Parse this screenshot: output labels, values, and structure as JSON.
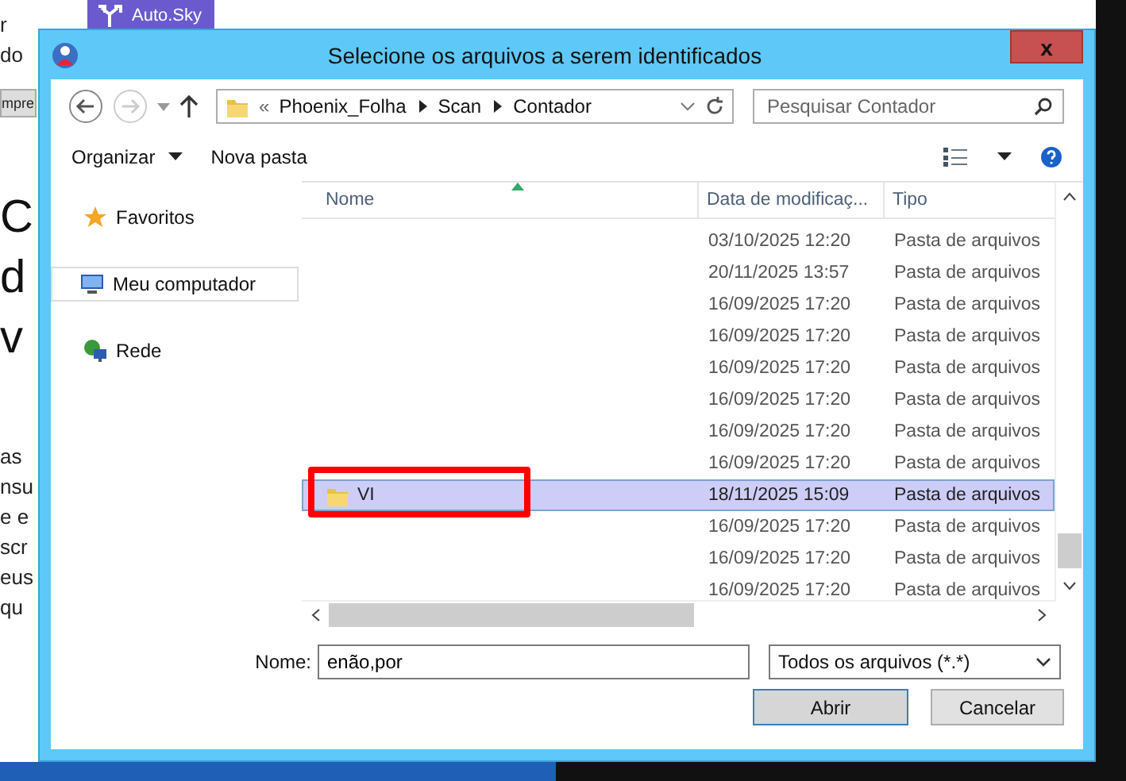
{
  "background": {
    "tab": "Auto.Sky",
    "fragments": [
      {
        "text": "r",
        "kind": "body"
      },
      {
        "text": "do",
        "kind": "body"
      },
      {
        "text": "mpre",
        "kind": "button"
      },
      {
        "text": "C",
        "kind": "heading"
      },
      {
        "text": "d",
        "kind": "heading"
      },
      {
        "text": "v",
        "kind": "heading"
      },
      {
        "text": "as",
        "kind": "body"
      },
      {
        "text": "nsu",
        "kind": "body"
      },
      {
        "text": "e e",
        "kind": "body"
      },
      {
        "text": "scr",
        "kind": "body"
      },
      {
        "text": "eus",
        "kind": "body"
      },
      {
        "text": "qu",
        "kind": "body"
      }
    ]
  },
  "window": {
    "title": "Selecione os arquivos a serem identificados",
    "close": "x"
  },
  "address": {
    "overflow": "«",
    "path": [
      "Phoenix_Folha",
      "Scan",
      "Contador"
    ]
  },
  "search": {
    "placeholder": "Pesquisar Contador"
  },
  "commands": [
    {
      "label": "Organizar",
      "dropdown": true
    },
    {
      "label": "Nova pasta",
      "dropdown": false
    }
  ],
  "sidebar": {
    "items": [
      {
        "label": "Favoritos",
        "selected": false
      },
      {
        "label": "Meu computador",
        "selected": true
      },
      {
        "label": "Rede",
        "selected": false
      }
    ]
  },
  "table": {
    "columns": [
      "Nome",
      "Data de modificaç...",
      "Tipo"
    ],
    "rows": [
      {
        "date": "03/10/2025 12:20",
        "type": "Pasta de arquivos",
        "selected": false
      },
      {
        "date": "20/11/2025 13:57",
        "type": "Pasta de arquivos",
        "selected": false
      },
      {
        "date": "16/09/2025 17:20",
        "type": "Pasta de arquivos",
        "selected": false
      },
      {
        "date": "16/09/2025 17:20",
        "type": "Pasta de arquivos",
        "selected": false
      },
      {
        "date": "16/09/2025 17:20",
        "type": "Pasta de arquivos",
        "selected": false
      },
      {
        "date": "16/09/2025 17:20",
        "type": "Pasta de arquivos",
        "selected": false
      },
      {
        "date": "16/09/2025 17:20",
        "type": "Pasta de arquivos",
        "selected": false
      },
      {
        "date": "16/09/2025 17:20",
        "type": "Pasta de arquivos",
        "selected": false
      },
      {
        "name": "VI",
        "date": "18/11/2025 15:09",
        "type": "Pasta de arquivos",
        "selected": true
      },
      {
        "date": "16/09/2025 17:20",
        "type": "Pasta de arquivos",
        "selected": false
      },
      {
        "date": "16/09/2025 17:20",
        "type": "Pasta de arquivos",
        "selected": false
      },
      {
        "date": "16/09/2025 17:20",
        "type": "Pasta de arquivos",
        "selected": false
      }
    ]
  },
  "filename": {
    "label": "Nome:",
    "value": "enão,por"
  },
  "filetype": {
    "value": "Todos os arquivos (*.*)"
  },
  "buttons": [
    {
      "label": "Abrir",
      "default": true
    },
    {
      "label": "Cancelar",
      "default": false
    }
  ]
}
